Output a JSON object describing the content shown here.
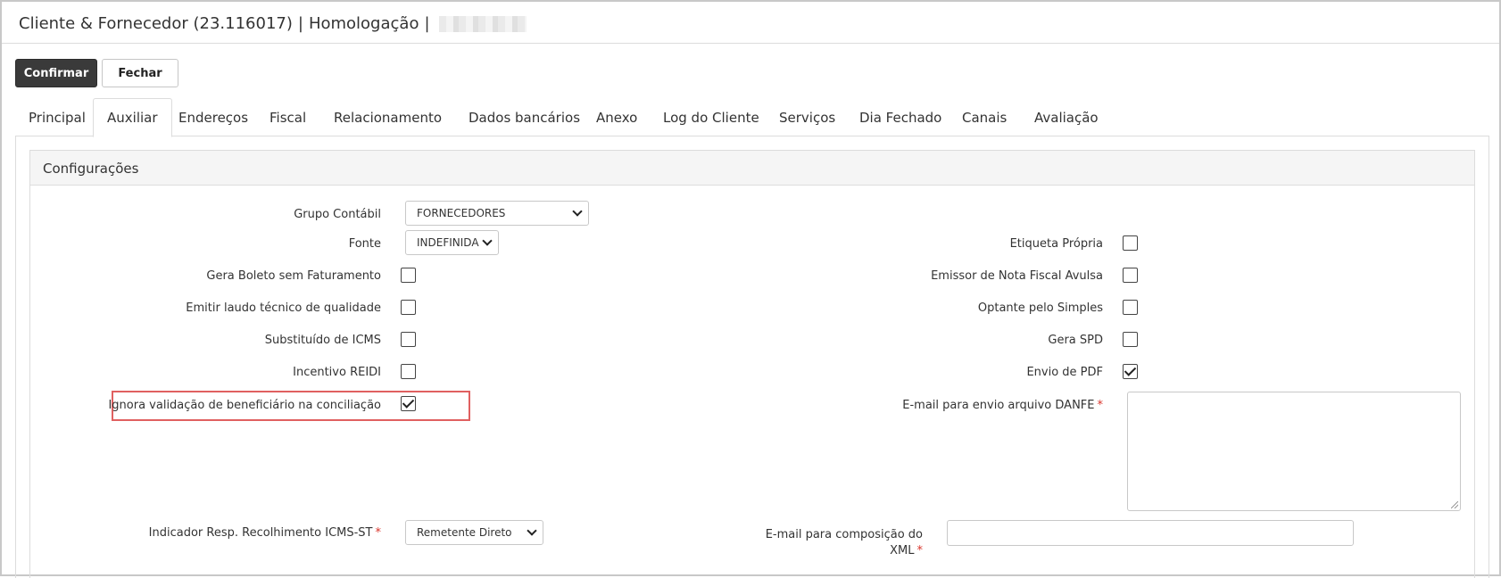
{
  "window": {
    "title_main": "Cliente & Fornecedor (23.116017)",
    "title_env": "Homologação"
  },
  "toolbar": {
    "confirm_label": "Confirmar",
    "close_label": "Fechar"
  },
  "tabs": [
    {
      "label": "Principal"
    },
    {
      "label": "Auxiliar"
    },
    {
      "label": "Endereços"
    },
    {
      "label": "Fiscal"
    },
    {
      "label": "Relacionamento"
    },
    {
      "label": "Dados bancários"
    },
    {
      "label": "Anexo"
    },
    {
      "label": "Log do Cliente"
    },
    {
      "label": "Serviços"
    },
    {
      "label": "Dia Fechado"
    },
    {
      "label": "Canais"
    },
    {
      "label": "Avaliação"
    }
  ],
  "active_tab": "Auxiliar",
  "panel": {
    "title": "Configurações"
  },
  "form": {
    "grupo_contabil": {
      "label": "Grupo Contábil",
      "value": "FORNECEDORES"
    },
    "fonte": {
      "label": "Fonte",
      "value": "INDEFINIDA"
    },
    "gera_boleto": {
      "label": "Gera Boleto sem Faturamento",
      "checked": false
    },
    "emitir_laudo": {
      "label": "Emitir laudo técnico de qualidade",
      "checked": false
    },
    "substituido_icms": {
      "label": "Substituído de ICMS",
      "checked": false
    },
    "incentivo_reidi": {
      "label": "Incentivo REIDI",
      "checked": false
    },
    "ignora_validacao": {
      "label": "Ignora validação de beneficiário na conciliação",
      "checked": true
    },
    "indicador_resp": {
      "label": "Indicador Resp. Recolhimento ICMS-ST",
      "required": "*",
      "value": "Remetente Direto"
    },
    "etiqueta_propria": {
      "label": "Etiqueta Própria",
      "checked": false
    },
    "emissor_nf_avulsa": {
      "label": "Emissor de Nota Fiscal Avulsa",
      "checked": false
    },
    "optante_simples": {
      "label": "Optante pelo Simples",
      "checked": false
    },
    "gera_spd": {
      "label": "Gera SPD",
      "checked": false
    },
    "envio_pdf": {
      "label": "Envio de PDF",
      "checked": true
    },
    "email_danfe": {
      "label": "E-mail para envio arquivo DANFE",
      "required": "*",
      "value": ""
    },
    "email_xml": {
      "label_line1": "E-mail para composição do",
      "label_line2": "XML",
      "required": "*",
      "value": ""
    }
  }
}
